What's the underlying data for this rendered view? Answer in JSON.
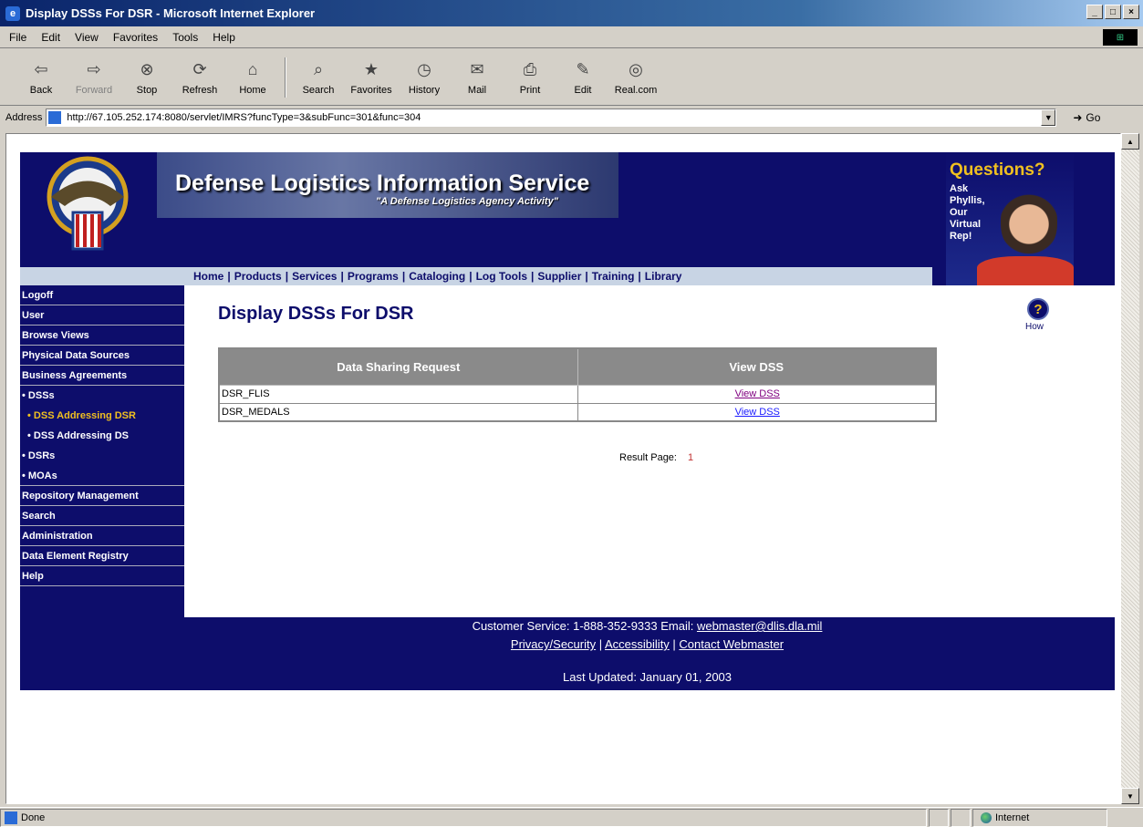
{
  "window": {
    "title": "Display DSSs For DSR - Microsoft Internet Explorer",
    "buttons": [
      "_",
      "□",
      "×"
    ]
  },
  "menu": [
    "File",
    "Edit",
    "View",
    "Favorites",
    "Tools",
    "Help"
  ],
  "toolbar": {
    "back": "Back",
    "forward": "Forward",
    "stop": "Stop",
    "refresh": "Refresh",
    "home": "Home",
    "search": "Search",
    "favorites": "Favorites",
    "history": "History",
    "mail": "Mail",
    "print": "Print",
    "edit": "Edit",
    "real": "Real.com"
  },
  "address": {
    "label": "Address",
    "url": "http://67.105.252.174:8080/servlet/IMRS?funcType=3&subFunc=301&func=304",
    "go": "Go"
  },
  "banner": {
    "title": "Defense Logistics Information Service",
    "subtitle": "\"A Defense Logistics Agency Activity\"",
    "questions_title": "Questions?",
    "questions_text": "Ask Phyllis, Our Virtual Rep!"
  },
  "topnav": [
    "Home",
    "Products",
    "Services",
    "Programs",
    "Cataloging",
    "Log Tools",
    "Supplier",
    "Training",
    "Library"
  ],
  "leftnav": [
    {
      "label": "Logoff",
      "level": 0,
      "active": false
    },
    {
      "label": "User",
      "level": 0,
      "active": false
    },
    {
      "label": "Browse Views",
      "level": 0,
      "active": false
    },
    {
      "label": "Physical Data Sources",
      "level": 0,
      "active": false
    },
    {
      "label": "Business Agreements",
      "level": 0,
      "active": false
    },
    {
      "label": "• DSSs",
      "level": 1,
      "active": false
    },
    {
      "label": "• DSS Addressing DSR",
      "level": 2,
      "active": true
    },
    {
      "label": "• DSS Addressing DS",
      "level": 2,
      "active": false
    },
    {
      "label": "• DSRs",
      "level": 1,
      "active": false
    },
    {
      "label": "• MOAs",
      "level": 1,
      "active": false
    },
    {
      "label": "Repository Management",
      "level": 0,
      "active": false
    },
    {
      "label": "Search",
      "level": 0,
      "active": false
    },
    {
      "label": "Administration",
      "level": 0,
      "active": false
    },
    {
      "label": "Data Element Registry",
      "level": 0,
      "active": false
    },
    {
      "label": "Help",
      "level": 0,
      "active": false
    }
  ],
  "main": {
    "heading": "Display DSSs For DSR",
    "help_label": "How",
    "table": {
      "headers": [
        "Data Sharing Request",
        "View DSS"
      ],
      "rows": [
        {
          "name": "DSR_FLIS",
          "link": "View DSS",
          "visited": true
        },
        {
          "name": "DSR_MEDALS",
          "link": "View DSS",
          "visited": false
        }
      ]
    },
    "result_label": "Result Page:",
    "result_page": "1"
  },
  "footer": {
    "service": "Customer Service: 1-888-352-9333 Email: ",
    "email": "webmaster@dlis.dla.mil",
    "links": [
      "Privacy/Security",
      "Accessibility",
      "Contact Webmaster"
    ],
    "updated": "Last Updated: January 01, 2003"
  },
  "status": {
    "text": "Done",
    "zone": "Internet"
  }
}
